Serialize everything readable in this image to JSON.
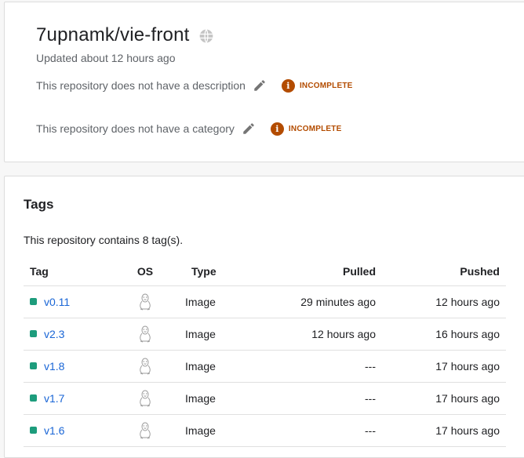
{
  "repo": {
    "title": "7upnamk/vie-front",
    "visibility_icon": "globe-icon",
    "updated": "Updated about 12 hours ago",
    "description_text": "This repository does not have a description",
    "category_text": "This repository does not have a category",
    "status_label": "INCOMPLETE",
    "status_color": "#b34c00"
  },
  "tags": {
    "heading": "Tags",
    "count_text": "This repository contains 8 tag(s).",
    "columns": {
      "tag": "Tag",
      "os": "OS",
      "type": "Type",
      "pulled": "Pulled",
      "pushed": "Pushed"
    },
    "rows": [
      {
        "tag": "v0.11",
        "os": "linux-icon",
        "type": "Image",
        "pulled": "29 minutes ago",
        "pushed": "12 hours ago"
      },
      {
        "tag": "v2.3",
        "os": "linux-icon",
        "type": "Image",
        "pulled": "12 hours ago",
        "pushed": "16 hours ago"
      },
      {
        "tag": "v1.8",
        "os": "linux-icon",
        "type": "Image",
        "pulled": "---",
        "pushed": "17 hours ago"
      },
      {
        "tag": "v1.7",
        "os": "linux-icon",
        "type": "Image",
        "pulled": "---",
        "pushed": "17 hours ago"
      },
      {
        "tag": "v1.6",
        "os": "linux-icon",
        "type": "Image",
        "pulled": "---",
        "pushed": "17 hours ago"
      }
    ],
    "status_dot_color": "#1d9c7c",
    "link_color": "#1a66d6"
  }
}
